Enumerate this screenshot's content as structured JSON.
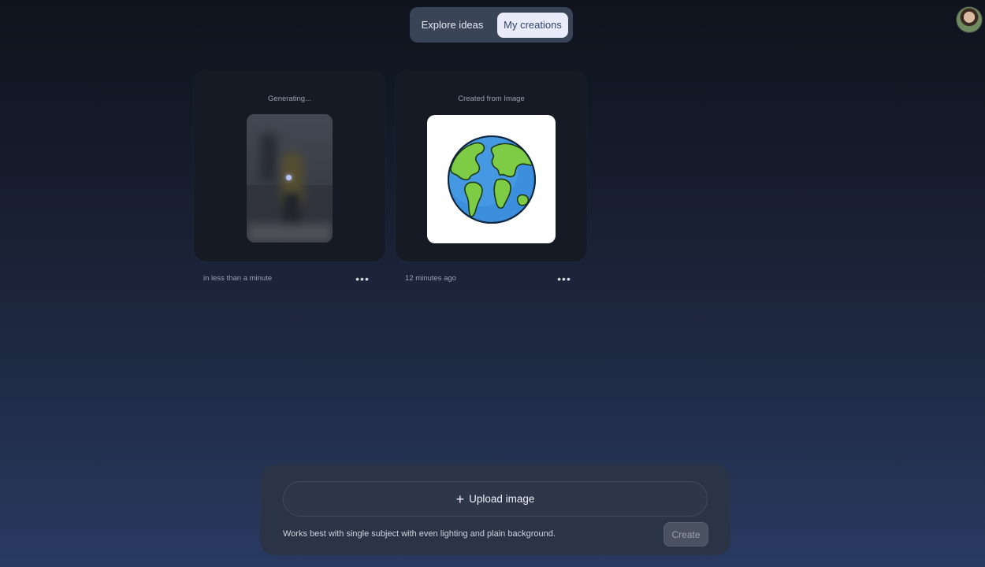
{
  "tabs": {
    "explore_label": "Explore ideas",
    "mine_label": "My creations",
    "active": "My creations"
  },
  "cards": [
    {
      "label": "Generating...",
      "meta": "in less than a minute",
      "more_label": "•••"
    },
    {
      "label": "Created from Image",
      "meta": "12 minutes ago",
      "more_label": "•••"
    }
  ],
  "composer": {
    "upload_icon": "+",
    "upload_label": "Upload image",
    "hint": "Works best with single subject with even lighting and plain background.",
    "create_label": "Create"
  },
  "icons": {
    "avatar": "user-avatar",
    "more": "more-horizontal-icon",
    "plus": "plus-icon",
    "globe": "globe-icon"
  },
  "colors": {
    "tab_active_bg": "#e9ecf8",
    "tab_active_text": "#33446a",
    "composer_bg": "#2b3446",
    "card_bg": "#151a25"
  }
}
